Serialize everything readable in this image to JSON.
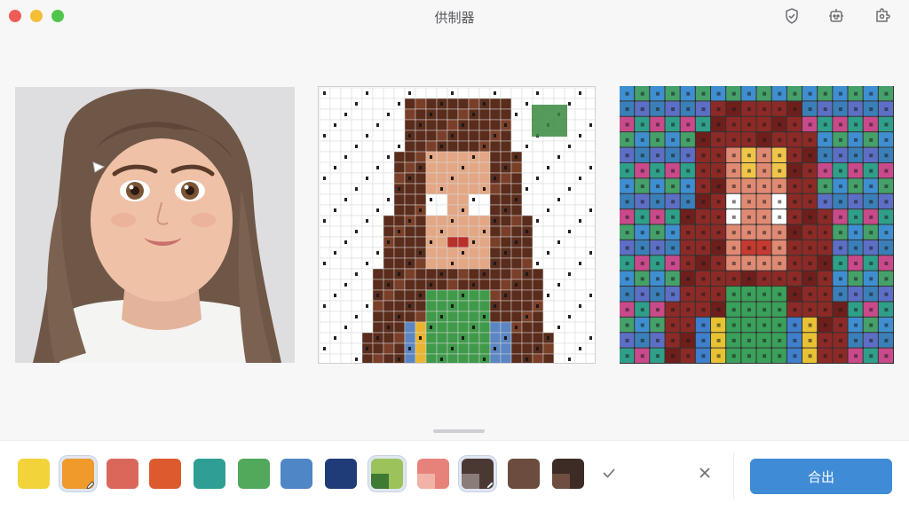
{
  "window": {
    "title": "供制器"
  },
  "toolbar_icons": [
    "shield-check-icon",
    "robot-icon",
    "puzzle-gear-icon"
  ],
  "panels": {
    "source_photo": "portrait-photo",
    "pattern_grid": "bead-pattern-chart",
    "mosaic_preview": "color-mosaic-preview"
  },
  "palette": {
    "swatches": [
      {
        "name": "yellow",
        "color": "#f2d43a"
      },
      {
        "name": "orange",
        "color": "#ef9a2b",
        "selected": true,
        "edit": true
      },
      {
        "name": "salmon",
        "color": "#d9685b"
      },
      {
        "name": "red-orange",
        "color": "#dc5a2e"
      },
      {
        "name": "teal",
        "color": "#2f9f93"
      },
      {
        "name": "green",
        "color": "#52a95c"
      },
      {
        "name": "blue",
        "color": "#4f86c6"
      },
      {
        "name": "navy",
        "color": "#1f3c78"
      },
      {
        "name": "olive-mix",
        "color": "#9bc25b",
        "selected": true
      },
      {
        "name": "salmon-mix",
        "color": "#e7827a"
      },
      {
        "name": "dark-brown-mix",
        "color": "#4a3833",
        "selected": true,
        "edit": true
      },
      {
        "name": "brown",
        "color": "#6b4c3e"
      },
      {
        "name": "dark-mix",
        "color": "#3d2b25"
      }
    ],
    "confirm_icon": "check-icon",
    "cancel_icon": "close-icon",
    "export_label": "合出"
  }
}
